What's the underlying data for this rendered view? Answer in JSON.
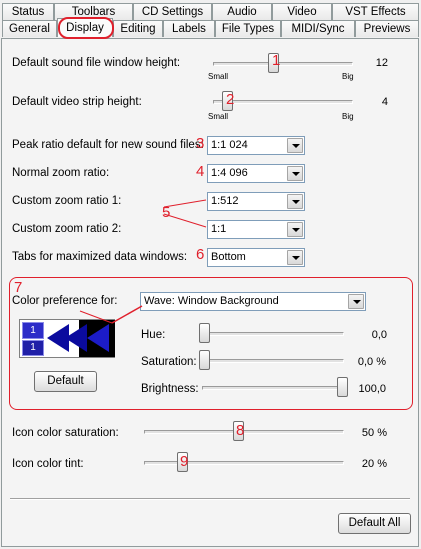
{
  "tabs": {
    "row1": [
      "Status",
      "Toolbars",
      "CD Settings",
      "Audio",
      "Video",
      "VST Effects"
    ],
    "row2": [
      "General",
      "Display",
      "Editing",
      "Labels",
      "File Types",
      "MIDI/Sync",
      "Previews"
    ],
    "active": "Display"
  },
  "settings": {
    "sound_window_height": {
      "label": "Default sound file window height:",
      "value": "12",
      "min_label": "Small",
      "max_label": "Big",
      "level": 0.55
    },
    "video_strip_height": {
      "label": "Default video strip height:",
      "value": "4",
      "min_label": "Small",
      "max_label": "Big",
      "level": 0.1
    },
    "peak_ratio": {
      "label": "Peak ratio default for new sound files:",
      "value": "1:1 024"
    },
    "normal_zoom": {
      "label": "Normal zoom ratio:",
      "value": "1:4 096"
    },
    "custom_zoom_1": {
      "label": "Custom zoom ratio 1:",
      "value": "1:512"
    },
    "custom_zoom_2": {
      "label": "Custom zoom ratio 2:",
      "value": "1:1"
    },
    "tabs_maximized": {
      "label": "Tabs for maximized data windows:",
      "value": "Bottom"
    }
  },
  "color": {
    "pref_label": "Color preference for:",
    "pref_value": "Wave: Window Background",
    "preview_labels": [
      "1",
      "1"
    ],
    "hue": {
      "label": "Hue:",
      "value": "0,0",
      "level": 0.0
    },
    "saturation": {
      "label": "Saturation:",
      "value": "0,0 %",
      "level": 0.0
    },
    "brightness": {
      "label": "Brightness:",
      "value": "100,0",
      "level": 1.0
    },
    "default_button": "Default"
  },
  "icons": {
    "saturation": {
      "label": "Icon color saturation:",
      "value": "50 %",
      "level": 0.45
    },
    "tint": {
      "label": "Icon color tint:",
      "value": "20 %",
      "level": 0.18
    }
  },
  "default_all_button": "Default All",
  "annotations": [
    "1",
    "2",
    "3",
    "4",
    "5",
    "6",
    "7",
    "8",
    "9"
  ],
  "colors": {
    "annotation": "#e0202c",
    "preview_blue": "#1f1fb0",
    "preview_dark": "#00007a"
  }
}
